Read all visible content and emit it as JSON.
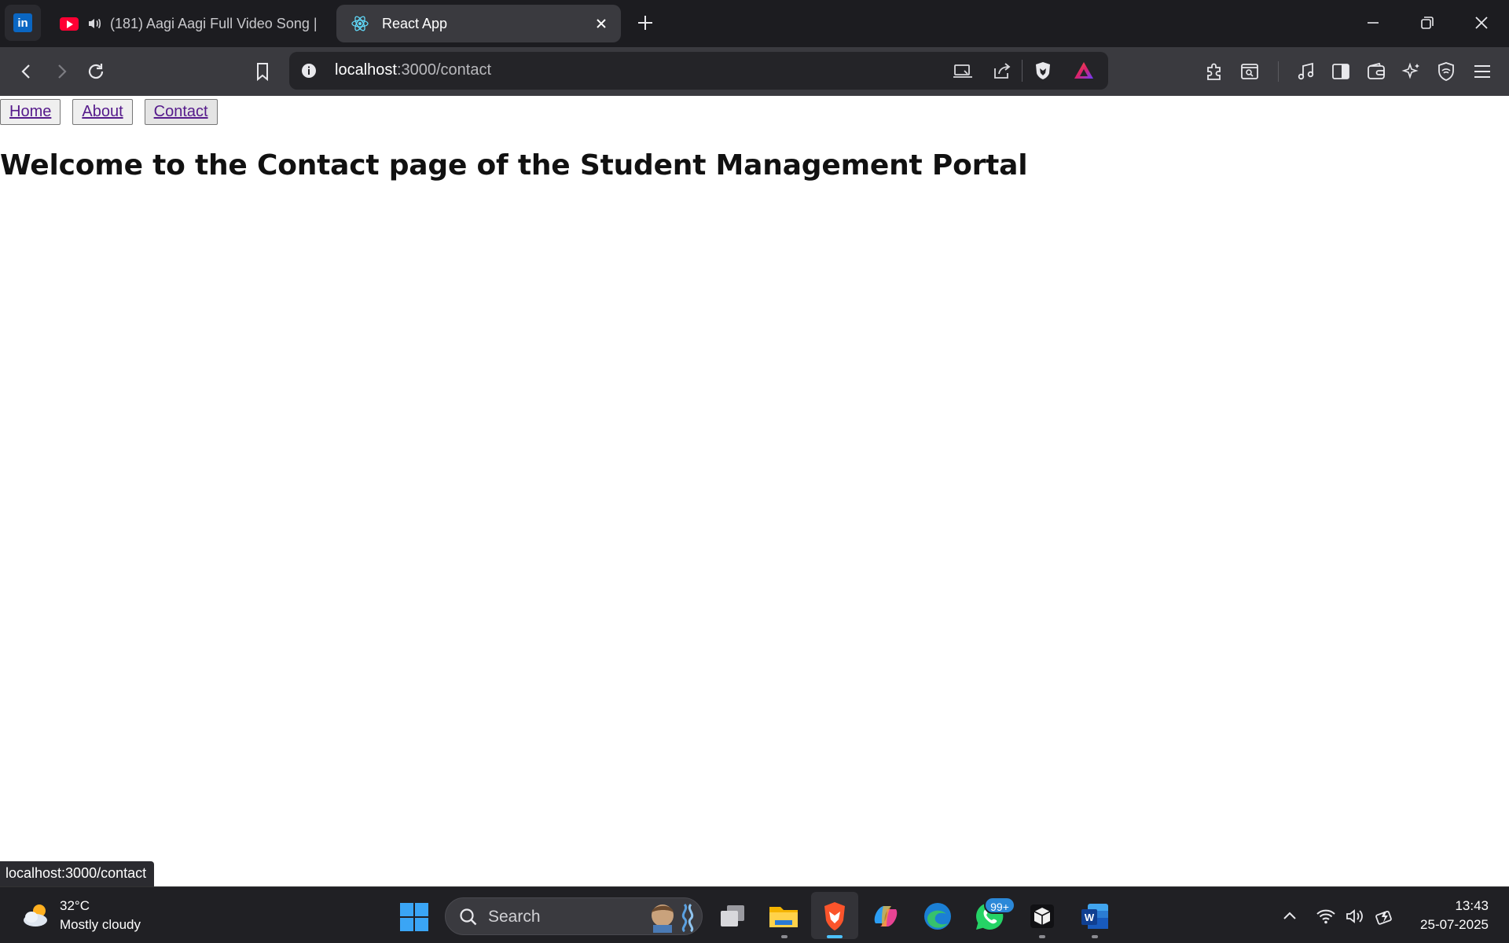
{
  "browser": {
    "pinned_tab": {
      "icon": "linkedin-icon",
      "letters": "in",
      "color": "#0a66c2"
    },
    "tabs": [
      {
        "title": "(181) Aagi Aagi Full Video Song |",
        "icon": "youtube-icon",
        "audio": "speaker-icon",
        "active": false
      },
      {
        "title": "React App",
        "icon": "react-icon",
        "active": true
      }
    ],
    "url": {
      "host": "localhost",
      "path": ":3000/contact"
    },
    "status_url": "localhost:3000/contact"
  },
  "page": {
    "nav": [
      {
        "label": "Home"
      },
      {
        "label": "About"
      },
      {
        "label": "Contact"
      }
    ],
    "heading": "Welcome to the Contact page of the Student Management Portal"
  },
  "taskbar": {
    "weather": {
      "temp": "32°C",
      "condition": "Mostly cloudy"
    },
    "search_placeholder": "Search",
    "whatsapp_badge": "99+",
    "clock": {
      "time": "13:43",
      "date": "25-07-2025"
    }
  },
  "colors": {
    "link": "#551a8b",
    "accent": "#4cc2ff",
    "tab_bar": "#1c1c20",
    "toolbar": "#3a3a3f"
  }
}
